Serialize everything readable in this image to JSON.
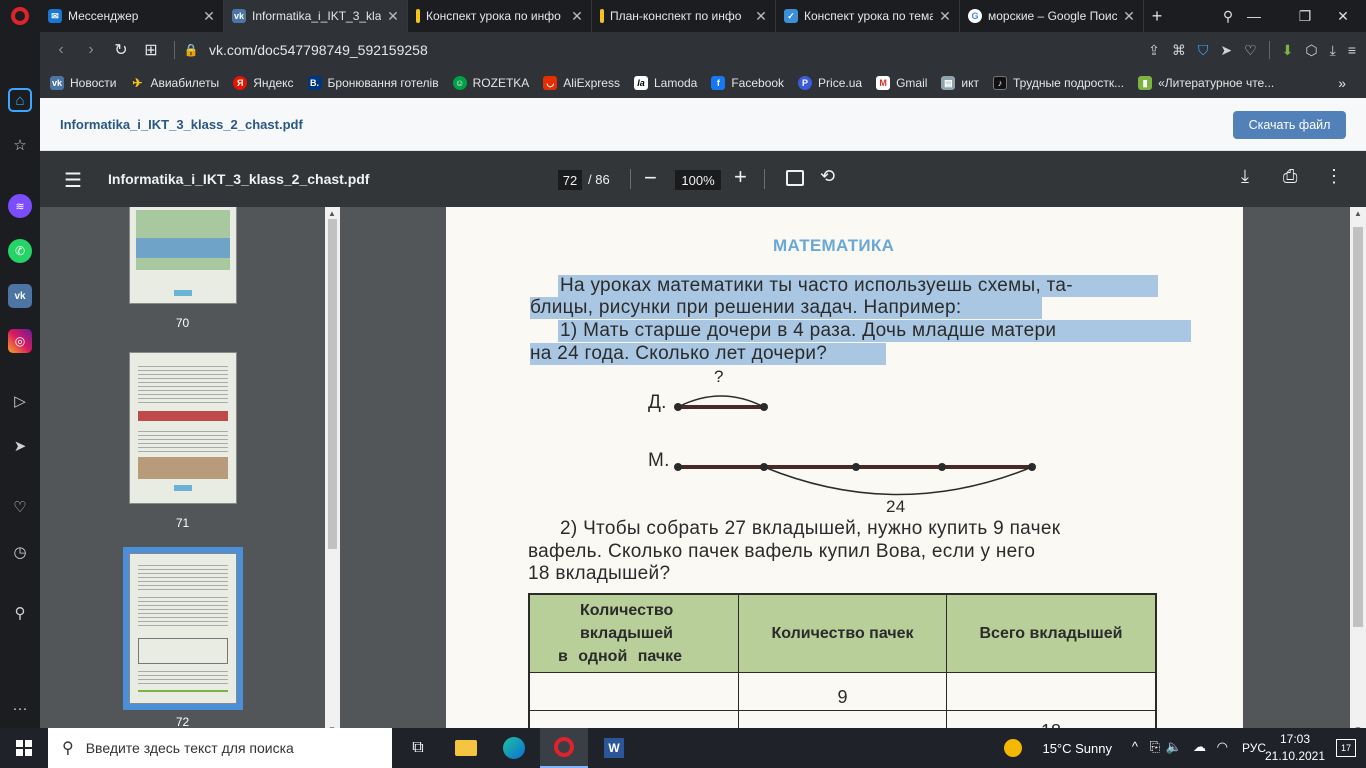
{
  "tabs": [
    {
      "title": "Мессенджер",
      "icon": "vk-messenger-icon",
      "color": "#1976d2",
      "active": false
    },
    {
      "title": "Informatika_i_IKT_3_klass",
      "icon": "vk-icon",
      "color": "#4c75a3",
      "active": true
    },
    {
      "title": "Конспект урока по инфо",
      "icon": "document-icon",
      "color": "#f5c518",
      "active": false
    },
    {
      "title": "План-конспект по инфо",
      "icon": "document-icon",
      "color": "#f5c518",
      "active": false
    },
    {
      "title": "Конспект урока по тема",
      "icon": "check-icon",
      "color": "#3b8fd8",
      "active": false
    },
    {
      "title": "морские – Google Поис",
      "icon": "google-icon",
      "color": "#ffffff",
      "active": false
    }
  ],
  "address": {
    "url": "vk.com/doc547798749_592159258"
  },
  "bookmarks": [
    {
      "label": "Новости",
      "icon": "vk-icon",
      "color": "#4c75a3"
    },
    {
      "label": "Авиабилеты",
      "icon": "plane-icon",
      "color": "#f5c518"
    },
    {
      "label": "Яндекс",
      "icon": "yandex-icon",
      "color": "#e61400"
    },
    {
      "label": "Бронювання готелів",
      "icon": "booking-icon",
      "color": "#003580"
    },
    {
      "label": "ROZETKA",
      "icon": "rozetka-icon",
      "color": "#00a046"
    },
    {
      "label": "AliExpress",
      "icon": "aliexpress-icon",
      "color": "#e62e04"
    },
    {
      "label": "Lamoda",
      "icon": "lamoda-icon",
      "color": "#000000"
    },
    {
      "label": "Facebook",
      "icon": "facebook-icon",
      "color": "#1877f2"
    },
    {
      "label": "Price.ua",
      "icon": "price-icon",
      "color": "#3b5bdb"
    },
    {
      "label": "Gmail",
      "icon": "gmail-icon",
      "color": "#d93025"
    },
    {
      "label": "икт",
      "icon": "book-icon",
      "color": "#90a4ae"
    },
    {
      "label": "Трудные подростк...",
      "icon": "tiktok-icon",
      "color": "#111111"
    },
    {
      "label": "«Литературное чте...",
      "icon": "bookmark-icon",
      "color": "#7cb342"
    }
  ],
  "vk": {
    "doc_title": "Informatika_i_IKT_3_klass_2_chast.pdf",
    "download_label": "Скачать файл"
  },
  "pdf": {
    "file_name": "Informatika_i_IKT_3_klass_2_chast.pdf",
    "current_page": "72",
    "total_pages": "/ 86",
    "zoom": "100%"
  },
  "thumbnails": [
    {
      "num": "70",
      "selected": false
    },
    {
      "num": "71",
      "selected": false
    },
    {
      "num": "72",
      "selected": true
    }
  ],
  "page": {
    "heading": "МАТЕМАТИКА",
    "para1_line1": "На уроках математики ты часто используешь схемы, та-",
    "para1_line2": "блицы, рисунки при решении задач. Например:",
    "task1_line1": "1) Мать старше дочери в 4 раза. Дочь младше матери",
    "task1_line2": "на 24 года. Сколько лет дочери?",
    "diagram": {
      "question": "?",
      "label_d": "Д.",
      "label_m": "М.",
      "difference": "24"
    },
    "task2_line1": "2) Чтобы собрать 27 вкладышей, нужно купить 9 пачек",
    "task2_line2": "вафель. Сколько пачек вафель купил Вова, если у него",
    "task2_line3": "18 вкладышей?",
    "table": {
      "headers": [
        "Количество вкладышей в одной пачке",
        "Количество пачек",
        "Всего вкладышей"
      ],
      "header_lines": [
        "Количество",
        "вкладышей",
        "в одной пачке"
      ],
      "rows": [
        [
          "",
          "9",
          ""
        ],
        [
          "",
          "",
          "18"
        ]
      ]
    }
  },
  "taskbar": {
    "search_placeholder": "Введите здесь текст для поиска",
    "weather": "15°C  Sunny",
    "lang": "РУС",
    "time": "17:03",
    "date": "21.10.2021",
    "notifications": "17"
  }
}
